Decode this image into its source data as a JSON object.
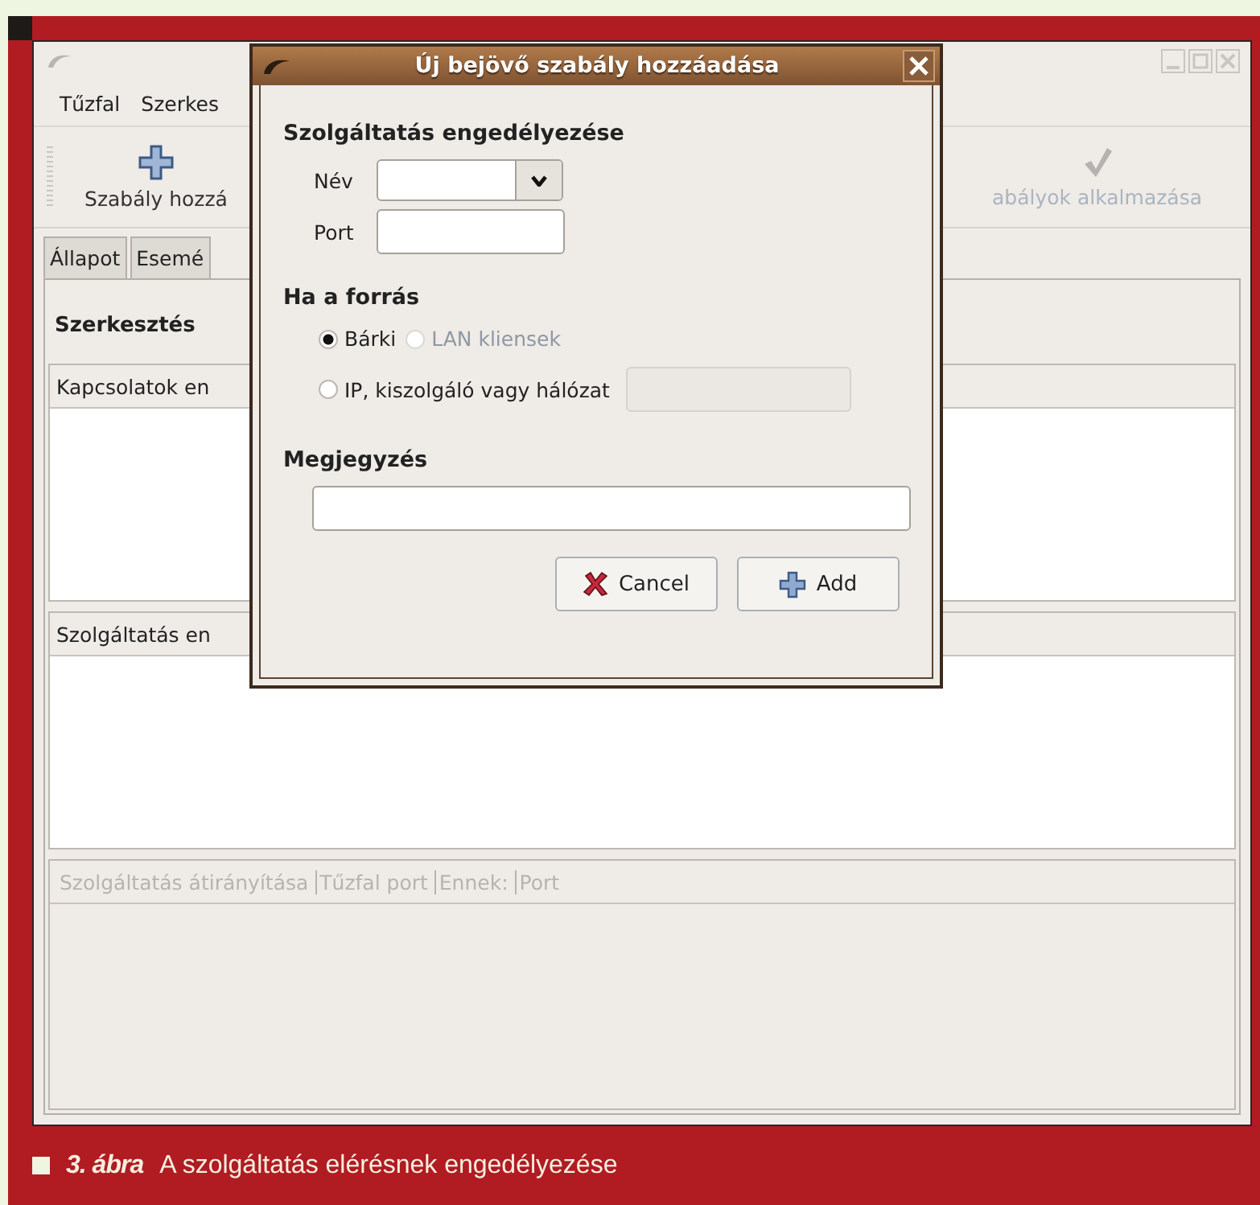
{
  "main_window": {
    "menu": [
      "Tűzfal",
      "Szerkes"
    ],
    "toolbar": [
      {
        "label": "Szabály hozzá",
        "kind": "add",
        "disabled": false
      },
      {
        "label": "abályok alkalmazása",
        "kind": "apply",
        "disabled": true
      }
    ],
    "tabs": [
      {
        "label": "Állapot",
        "selected": false
      },
      {
        "label": "Esemé",
        "selected": false
      }
    ],
    "edit_label": "Szerkesztés",
    "lists": [
      {
        "header": "Kapcsolatok en"
      },
      {
        "header": "Szolgáltatás en"
      }
    ],
    "forward_table": {
      "disabled": true,
      "columns": [
        "Szolgáltatás átirányítása",
        "Tűzfal port",
        "Ennek:",
        "Port"
      ]
    }
  },
  "dialog": {
    "title": "Új bejövő szabály hozzáadása",
    "service_heading": "Szolgáltatás engedélyezése",
    "name_label": "Név",
    "port_label": "Port",
    "source_heading": "Ha a forrás",
    "radios": [
      {
        "label": "Bárki",
        "selected": true,
        "disabled": false,
        "kind": "plain"
      },
      {
        "label": "LAN kliensek",
        "selected": false,
        "disabled": true,
        "kind": "plain"
      },
      {
        "label": "IP, kiszolgáló vagy hálózat",
        "selected": false,
        "disabled": false,
        "kind": "with_field",
        "field_disabled": true
      }
    ],
    "note_heading": "Megjegyzés",
    "buttons": [
      {
        "label": "Cancel",
        "kind": "cancel"
      },
      {
        "label": "Add",
        "kind": "add"
      }
    ]
  },
  "caption": {
    "figure_label": "3. ábra",
    "text": "A szolgáltatás elérésnek engedélyezése"
  }
}
